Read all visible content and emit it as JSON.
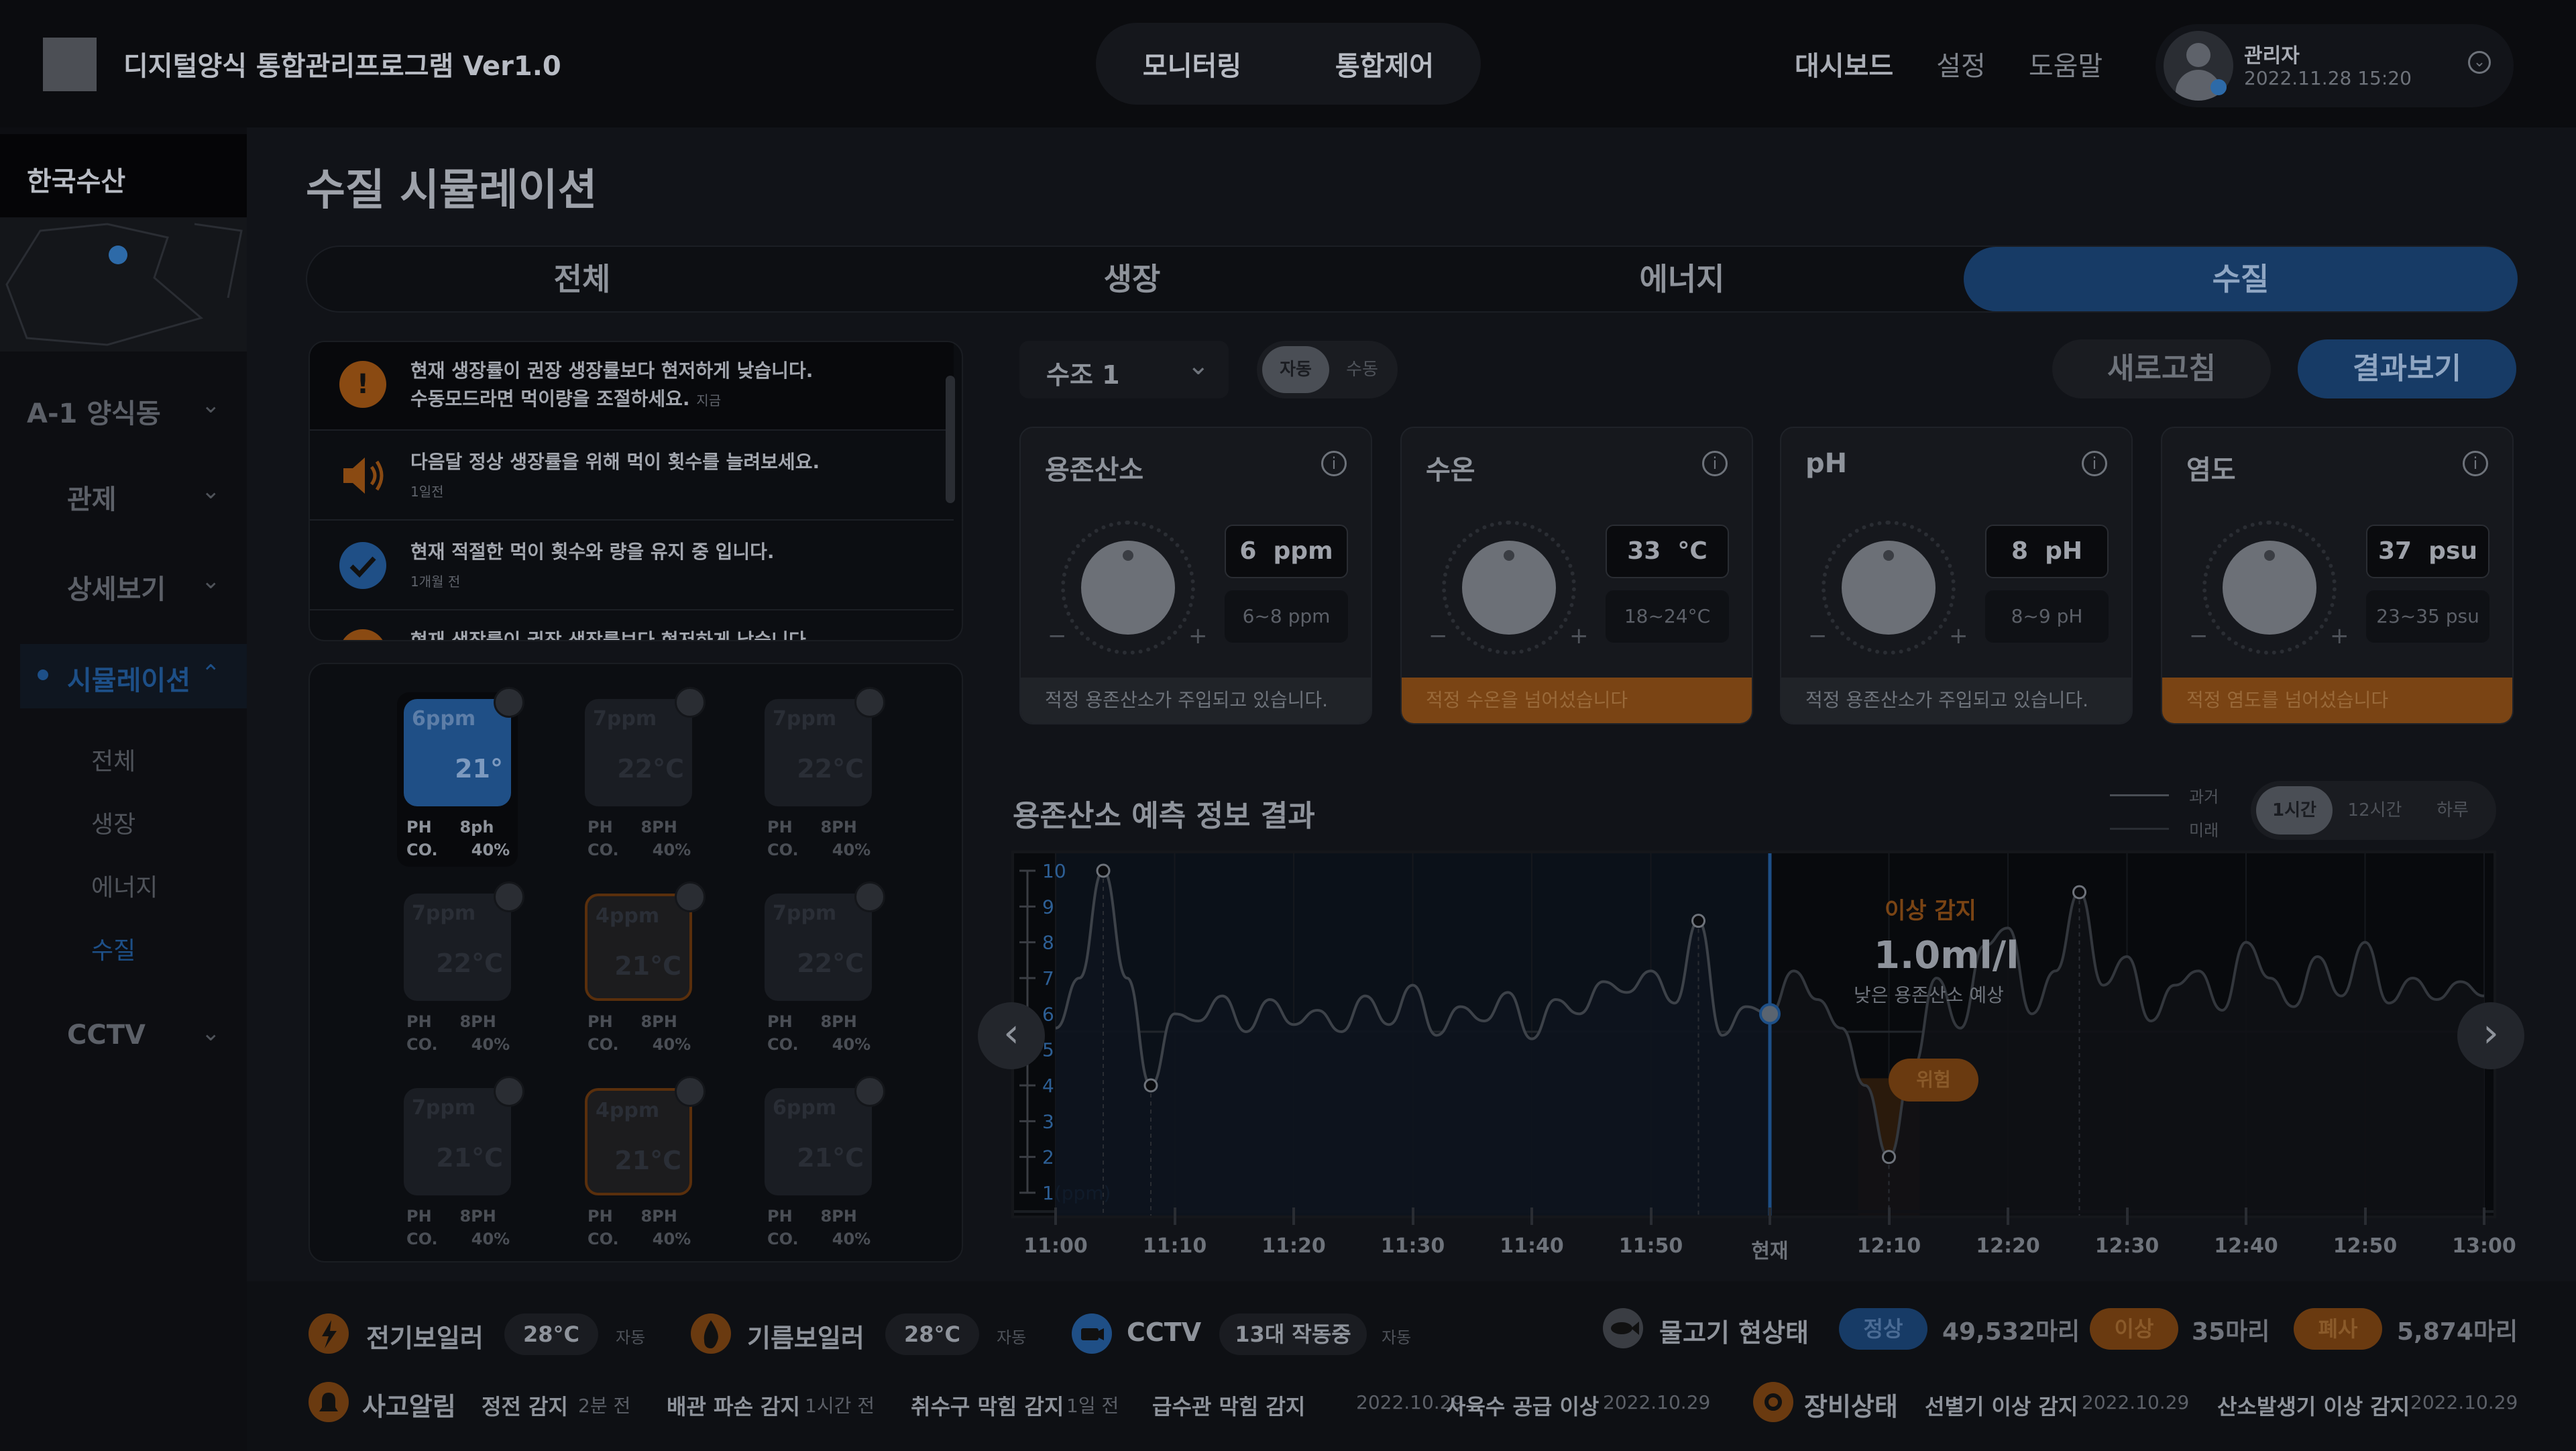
{
  "header": {
    "app_title": "디지털양식 통합관리프로그램 Ver1.0",
    "nav": [
      "모니터링",
      "통합제어"
    ],
    "links": [
      "대시보드",
      "설정",
      "도움말"
    ],
    "user_name": "관리자",
    "user_datetime": "2022.11.28 15:20"
  },
  "sidebar": {
    "company": "한국수산",
    "building": "A-1 양식동",
    "items": [
      "관제",
      "상세보기",
      "시뮬레이션",
      "CCTV"
    ],
    "sim_sub": [
      "전체",
      "생장",
      "에너지",
      "수질"
    ],
    "active_item": "시뮬레이션",
    "active_sub": "수질"
  },
  "page": {
    "title": "수질 시뮬레이션",
    "tabs": [
      "전체",
      "생장",
      "에너지",
      "수질"
    ],
    "active_tab": "수질"
  },
  "alerts": [
    {
      "text": "현재 생장률이 권장 생장률보다 현저하게 낮습니다.",
      "text2": "수동모드라면 먹이량을 조절하세요.",
      "time": "지금",
      "icon": "warning-icon",
      "color": "#8a4a12"
    },
    {
      "text": "다음달 정상 생장률을 위해 먹이 횟수를 늘려보세요.",
      "time": "1일전",
      "icon": "speaker-icon",
      "color": "#8a4a12"
    },
    {
      "text": "현재 적절한 먹이 횟수와 량을 유지 중 입니다.",
      "time": "1개월 전",
      "icon": "check-icon",
      "color": "#1f4f86"
    },
    {
      "text": "현재 생장률이 권장 생장률보다 현저하게 낮습니다.",
      "icon": "warning-icon",
      "color": "#8a4a12"
    }
  ],
  "tanks": [
    {
      "ppm": "6ppm",
      "temp": "21°",
      "ph": "PH",
      "ph_val": "8ph",
      "co": "CO.",
      "co_val": "40%",
      "state": "selected"
    },
    {
      "ppm": "7ppm",
      "temp": "22°C",
      "ph": "PH",
      "ph_val": "8PH",
      "co": "CO.",
      "co_val": "40%",
      "state": "normal"
    },
    {
      "ppm": "7ppm",
      "temp": "22°C",
      "ph": "PH",
      "ph_val": "8PH",
      "co": "CO.",
      "co_val": "40%",
      "state": "normal"
    },
    {
      "ppm": "7ppm",
      "temp": "22°C",
      "ph": "PH",
      "ph_val": "8PH",
      "co": "CO.",
      "co_val": "40%",
      "state": "normal"
    },
    {
      "ppm": "4ppm",
      "temp": "21°C",
      "ph": "PH",
      "ph_val": "8PH",
      "co": "CO.",
      "co_val": "40%",
      "state": "warning"
    },
    {
      "ppm": "7ppm",
      "temp": "22°C",
      "ph": "PH",
      "ph_val": "8PH",
      "co": "CO.",
      "co_val": "40%",
      "state": "normal"
    },
    {
      "ppm": "7ppm",
      "temp": "21°C",
      "ph": "PH",
      "ph_val": "8PH",
      "co": "CO.",
      "co_val": "40%",
      "state": "normal"
    },
    {
      "ppm": "4ppm",
      "temp": "21°C",
      "ph": "PH",
      "ph_val": "8PH",
      "co": "CO.",
      "co_val": "40%",
      "state": "warning"
    },
    {
      "ppm": "6ppm",
      "temp": "21°C",
      "ph": "PH",
      "ph_val": "8PH",
      "co": "CO.",
      "co_val": "40%",
      "state": "normal"
    }
  ],
  "controls": {
    "tank_select": "수조 1",
    "mode_auto": "자동",
    "mode_manual": "수동",
    "refresh": "새로고침",
    "result": "결과보기"
  },
  "sensors": [
    {
      "title": "용존산소",
      "value": "6",
      "unit": "ppm",
      "range": "6~8 ppm",
      "status": "적정 용존산소가 주입되고 있습니다.",
      "status_type": "normal"
    },
    {
      "title": "수온",
      "value": "33",
      "unit": "°C",
      "range": "18~24°C",
      "status": "적정 수온을 넘어섰습니다",
      "status_type": "warning"
    },
    {
      "title": "pH",
      "value": "8",
      "unit": "pH",
      "range": "8~9 pH",
      "status": "적정 용존산소가 주입되고 있습니다.",
      "status_type": "normal"
    },
    {
      "title": "염도",
      "value": "37",
      "unit": "psu",
      "range": "23~35 psu",
      "status": "적정 염도를 넘어섰습니다",
      "status_type": "warning"
    }
  ],
  "forecast": {
    "title": "용존산소 예측 정보 결과",
    "legend_past": "과거",
    "legend_future": "미래",
    "ranges": [
      "1시간",
      "12시간",
      "하루"
    ],
    "active_range": "1시간",
    "anomaly_label": "이상 감지",
    "anomaly_value": "1.0ml/l",
    "anomaly_desc": "낮은 용존산소 예상",
    "danger_label": "위험"
  },
  "chart_data": {
    "type": "line",
    "title": "용존산소 예측 정보 결과",
    "ylabel": "",
    "y_unit_label": "1(ppm)",
    "ylim": [
      1,
      10
    ],
    "y_ticks": [
      "10",
      "9",
      "8",
      "7",
      "6",
      "5",
      "4",
      "3",
      "2",
      "1(ppm)"
    ],
    "x_tick_labels": [
      "11:00",
      "11:10",
      "11:20",
      "11:30",
      "11:40",
      "11:50",
      "현재",
      "12:10",
      "12:20",
      "12:30",
      "12:40",
      "12:50",
      "13:00"
    ],
    "series": [
      {
        "name": "과거",
        "x": [
          0,
          2,
          4,
          6,
          8,
          10,
          12,
          14,
          16,
          18,
          20,
          22,
          24,
          26,
          28,
          30,
          32,
          34,
          36,
          38,
          40,
          42,
          44,
          46,
          48,
          50,
          52,
          54,
          56,
          58,
          60
        ],
        "values": [
          5.6,
          7.0,
          10.0,
          7.0,
          4.0,
          6.0,
          5.8,
          6.5,
          5.5,
          6.4,
          5.7,
          6.1,
          5.5,
          6.5,
          5.7,
          6.8,
          5.4,
          6.2,
          5.8,
          6.6,
          5.3,
          6.4,
          6.0,
          6.9,
          6.6,
          7.2,
          6.3,
          8.6,
          5.4,
          6.2,
          6.0
        ]
      },
      {
        "name": "미래",
        "x": [
          60,
          62,
          64,
          66,
          68,
          70,
          72,
          74,
          76,
          78,
          80,
          82,
          84,
          86,
          88,
          90,
          92,
          94,
          96,
          98,
          100,
          102,
          104,
          106,
          108,
          110,
          112,
          114,
          116,
          118,
          120
        ],
        "values": [
          6.0,
          7.2,
          6.4,
          5.6,
          4.0,
          2.0,
          4.5,
          7.0,
          5.6,
          7.9,
          8.4,
          6.0,
          7.2,
          9.4,
          6.8,
          7.6,
          5.8,
          6.8,
          7.2,
          6.1,
          8.0,
          7.0,
          6.2,
          7.6,
          6.5,
          8.0,
          6.3,
          7.0,
          6.4,
          6.9,
          6.5
        ]
      }
    ],
    "current_x": 60,
    "current_value": 6.0,
    "anomaly_x": 70,
    "anomaly_value": 2.0
  },
  "footer": {
    "boiler_e_label": "전기보일러",
    "boiler_e_val": "28°C",
    "boiler_e_mode": "자동",
    "boiler_o_label": "기름보일러",
    "boiler_o_val": "28°C",
    "boiler_o_mode": "자동",
    "cctv_label": "CCTV",
    "cctv_val": "13대 작동중",
    "cctv_mode": "자동",
    "fish_label": "물고기 현상태",
    "fish_normal": "정상",
    "fish_normal_count": "49,532마리",
    "fish_abnormal": "이상",
    "fish_abnormal_count": "35마리",
    "fish_dead": "폐사",
    "fish_dead_count": "5,874마리",
    "accident_label": "사고알림",
    "accidents": [
      {
        "name": "정전 감지",
        "time": "2분 전"
      },
      {
        "name": "배관 파손 감지",
        "time": "1시간 전"
      },
      {
        "name": "취수구 막힘 감지",
        "time": "1일 전"
      },
      {
        "name": "급수관 막힘 감지",
        "time": "2022.10.29"
      },
      {
        "name": "사육수 공급 이상",
        "time": "2022.10.29"
      }
    ],
    "equip_label": "장비상태",
    "equipment": [
      {
        "name": "선별기 이상 감지",
        "time": "2022.10.29"
      },
      {
        "name": "산소발생기 이상 감지",
        "time": "2022.10.29"
      }
    ]
  },
  "colors": {
    "accent": "#173b66",
    "warning": "#8a4a12",
    "normal_badge": "#1f4f86"
  }
}
